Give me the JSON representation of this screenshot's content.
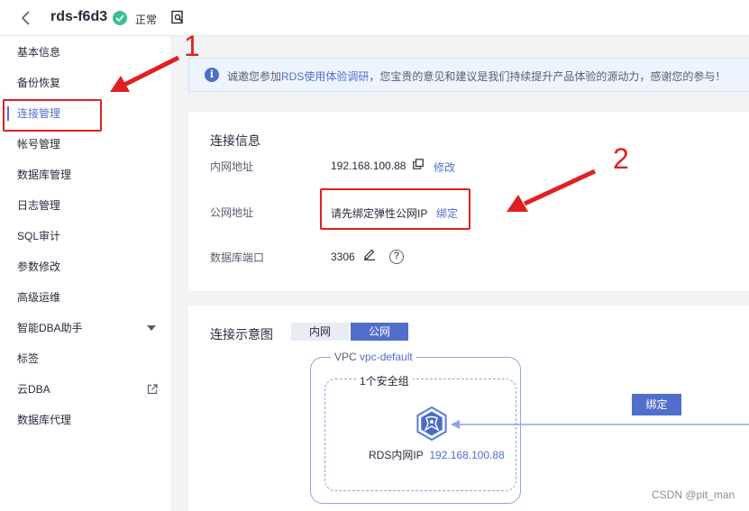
{
  "header": {
    "instance_name": "rds-f6d3",
    "status": "正常"
  },
  "sidebar": {
    "items": [
      {
        "label": "基本信息"
      },
      {
        "label": "备份恢复"
      },
      {
        "label": "连接管理",
        "active": true
      },
      {
        "label": "帐号管理"
      },
      {
        "label": "数据库管理"
      },
      {
        "label": "日志管理"
      },
      {
        "label": "SQL审计"
      },
      {
        "label": "参数修改"
      },
      {
        "label": "高级运维"
      },
      {
        "label": "智能DBA助手",
        "expandable": true
      },
      {
        "label": "标签"
      },
      {
        "label": "云DBA",
        "external": true
      },
      {
        "label": "数据库代理"
      }
    ]
  },
  "notice": {
    "prefix": "诚邀您参加",
    "link": "RDS使用体验调研",
    "suffix": "，您宝贵的意见和建议是我们持续提升产品体验的源动力，感谢您的参与！"
  },
  "connection_info": {
    "title": "连接信息",
    "private_label": "内网地址",
    "private_value": "192.168.100.88",
    "private_action": "修改",
    "public_label": "公网地址",
    "public_value": "请先绑定弹性公网IP",
    "public_action": "绑定",
    "port_label": "数据库端口",
    "port_value": "3306"
  },
  "diagram": {
    "title": "连接示意图",
    "tabs": [
      {
        "label": "内网",
        "selected": false
      },
      {
        "label": "公网",
        "selected": true
      }
    ],
    "vpc_prefix": "VPC",
    "vpc_name": "vpc-default",
    "security_group": "1个安全组",
    "rds_ip_label": "RDS内网IP",
    "rds_ip_value": "192.168.100.88",
    "bind_button": "绑定"
  },
  "annotations": {
    "step1": "1",
    "step2": "2"
  },
  "watermark": "CSDN @pit_man",
  "colors": {
    "accent": "#526ecc",
    "status_ok": "#3bbf8f",
    "annotation": "#e02020"
  }
}
